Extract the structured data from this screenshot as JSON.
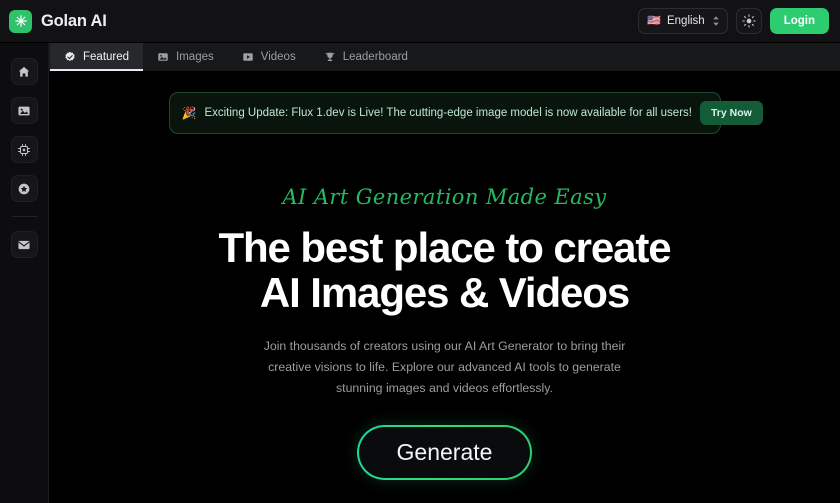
{
  "brand": {
    "name": "Golan AI",
    "logo_icon": "asterisk-star-icon",
    "logo_color": "#2ec26b"
  },
  "topbar": {
    "language": {
      "flag": "🇺🇸",
      "label": "English",
      "chevron_icon": "chevron-up-down-icon"
    },
    "theme_toggle_icon": "sun-icon",
    "login_label": "Login",
    "login_color": "#2ecc71"
  },
  "sidebar": {
    "items": [
      {
        "icon": "home-icon",
        "name": "sidebar-item-home"
      },
      {
        "icon": "image-icon",
        "name": "sidebar-item-images"
      },
      {
        "icon": "cpu-chip-icon",
        "name": "sidebar-item-models"
      },
      {
        "icon": "star-circle-icon",
        "name": "sidebar-item-favorites"
      },
      {
        "icon": "mail-icon",
        "name": "sidebar-item-mail"
      }
    ]
  },
  "tabs": [
    {
      "label": "Featured",
      "icon": "verified-badge-icon",
      "active": true
    },
    {
      "label": "Images",
      "icon": "image-icon",
      "active": false
    },
    {
      "label": "Videos",
      "icon": "video-play-icon",
      "active": false
    },
    {
      "label": "Leaderboard",
      "icon": "trophy-icon",
      "active": false
    }
  ],
  "banner": {
    "emoji": "🎉",
    "text": "Exciting Update: Flux 1.dev is Live! The cutting-edge image model is now available for all users!",
    "button_label": "Try Now",
    "accent_color": "#1d4a32"
  },
  "hero": {
    "script_tagline": "AI Art Generation Made Easy",
    "title_line1": "The best place to create",
    "title_line2": "AI Images & Videos",
    "subtitle": "Join thousands of creators using our AI Art Generator to bring their creative visions to life. Explore our advanced AI tools to generate stunning images and videos effortlessly.",
    "cta_label": "Generate",
    "cta_border_color": "#2ecc71"
  }
}
